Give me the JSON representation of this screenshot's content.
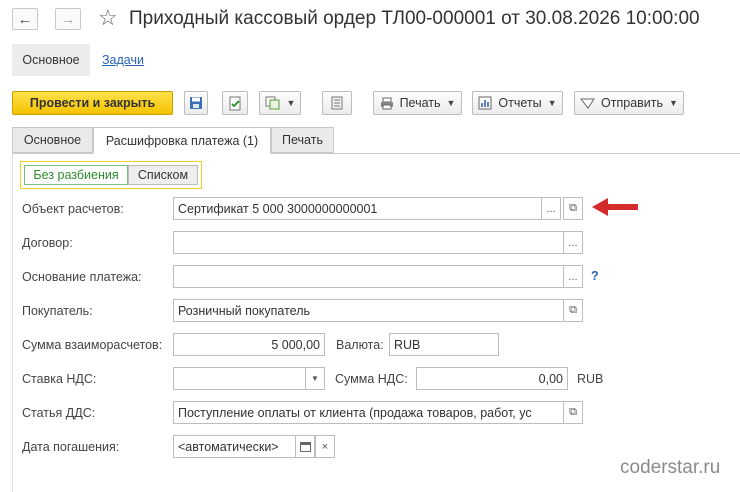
{
  "window": {
    "title": "Приходный кассовый ордер ТЛ00-000001 от 30.08.2026 10:00:00",
    "nav_back_icon": "arrow-left-icon",
    "nav_forward_icon": "arrow-right-icon",
    "favorite_icon": "star-icon"
  },
  "top_nav": {
    "main": "Основное",
    "tasks": "Задачи"
  },
  "toolbar": {
    "post_and_close": "Провести и закрыть",
    "print": "Печать",
    "reports": "Отчеты",
    "send": "Отправить"
  },
  "tabs": [
    "Основное",
    "Расшифровка платежа (1)",
    "Печать"
  ],
  "split_mode": {
    "no_split": "Без разбиения",
    "list": "Списком"
  },
  "form": {
    "settlement_object": {
      "label": "Объект расчетов:",
      "value": "Сертификат 5 000 3000000000001"
    },
    "contract": {
      "label": "Договор:",
      "value": ""
    },
    "payment_basis": {
      "label": "Основание платежа:",
      "value": "",
      "help": "?"
    },
    "buyer": {
      "label": "Покупатель:",
      "value": "Розничный покупатель"
    },
    "settlement_amount": {
      "label": "Сумма взаиморасчетов:",
      "value": "5 000,00"
    },
    "currency": {
      "label": "Валюта:",
      "value": "RUB"
    },
    "vat_rate": {
      "label": "Ставка НДС:",
      "value": ""
    },
    "vat_amount": {
      "label": "Сумма НДС:",
      "value": "0,00",
      "currency": "RUB"
    },
    "cash_flow_item": {
      "label": "Статья ДДС:",
      "value": "Поступление оплаты от клиента (продажа товаров, работ, ус"
    },
    "due_date": {
      "label": "Дата погашения:",
      "value": "<автоматически>"
    }
  },
  "watermark": "coderstar.ru",
  "colors": {
    "primary_button": "#f4c200",
    "arrow": "#d42a2a",
    "link": "#2a64b5",
    "selected_radio": "#2e8b2e"
  }
}
